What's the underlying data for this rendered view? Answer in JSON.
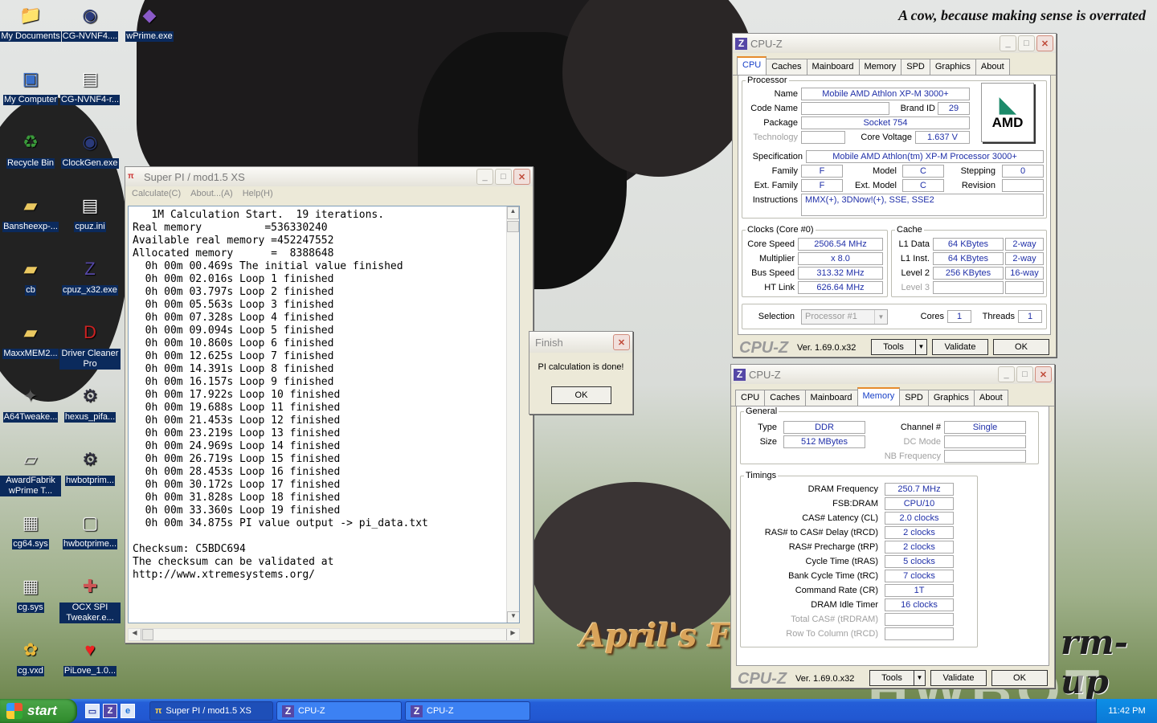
{
  "desktop": {
    "slogan": "A cow, because making sense is overrated",
    "banner_left": "April's F",
    "banner_right": "rm-up",
    "banner_logo": "HWBOT",
    "icons": [
      {
        "label": "My Documents",
        "icon": "folder-documents-icon"
      },
      {
        "label": "CG-NVNF4....",
        "icon": "clockgen-icon"
      },
      {
        "label": "wPrime.exe",
        "icon": "wprime-icon"
      },
      {
        "label": "My Computer",
        "icon": "computer-icon"
      },
      {
        "label": "CG-NVNF4-r...",
        "icon": "text-file-icon"
      },
      {
        "label": "Recycle Bin",
        "icon": "recycle-bin-icon"
      },
      {
        "label": "ClockGen.exe",
        "icon": "clockgen-icon"
      },
      {
        "label": "Bansheexp-...",
        "icon": "folder-icon"
      },
      {
        "label": "cpuz.ini",
        "icon": "ini-file-icon"
      },
      {
        "label": "cb",
        "icon": "folder-icon"
      },
      {
        "label": "cpuz_x32.exe",
        "icon": "cpuz-icon"
      },
      {
        "label": "MaxxMEM2...",
        "icon": "folder-icon"
      },
      {
        "label": "Driver Cleaner Pro",
        "icon": "driver-cleaner-icon"
      },
      {
        "label": "A64Tweake...",
        "icon": "a64tweaker-icon"
      },
      {
        "label": "hexus_pifa...",
        "icon": "app-window-icon"
      },
      {
        "label": "AwardFabrik wPrime T...",
        "icon": "award-icon"
      },
      {
        "label": "hwbotprim...",
        "icon": "app-window-icon"
      },
      {
        "label": "cg64.sys",
        "icon": "sys-file-icon"
      },
      {
        "label": "hwbotprime...",
        "icon": "file-icon"
      },
      {
        "label": "cg.sys",
        "icon": "sys-file-icon"
      },
      {
        "label": "OCX SPI Tweaker.e...",
        "icon": "ocx-icon"
      },
      {
        "label": "cg.vxd",
        "icon": "vxd-file-icon"
      },
      {
        "label": "PiLove_1.0...",
        "icon": "heart-icon"
      }
    ]
  },
  "superpi": {
    "title": "Super PI / mod1.5 XS",
    "menu": [
      "Calculate(C)",
      "About...(A)",
      "Help(H)"
    ],
    "output": "   1M Calculation Start.  19 iterations.\nReal memory          =536330240\nAvailable real memory =452247552\nAllocated memory      =  8388648\n  0h 00m 00.469s The initial value finished\n  0h 00m 02.016s Loop 1 finished\n  0h 00m 03.797s Loop 2 finished\n  0h 00m 05.563s Loop 3 finished\n  0h 00m 07.328s Loop 4 finished\n  0h 00m 09.094s Loop 5 finished\n  0h 00m 10.860s Loop 6 finished\n  0h 00m 12.625s Loop 7 finished\n  0h 00m 14.391s Loop 8 finished\n  0h 00m 16.157s Loop 9 finished\n  0h 00m 17.922s Loop 10 finished\n  0h 00m 19.688s Loop 11 finished\n  0h 00m 21.453s Loop 12 finished\n  0h 00m 23.219s Loop 13 finished\n  0h 00m 24.969s Loop 14 finished\n  0h 00m 26.719s Loop 15 finished\n  0h 00m 28.453s Loop 16 finished\n  0h 00m 30.172s Loop 17 finished\n  0h 00m 31.828s Loop 18 finished\n  0h 00m 33.360s Loop 19 finished\n  0h 00m 34.875s PI value output -> pi_data.txt\n\nChecksum: C5BDC694\nThe checksum can be validated at\nhttp://www.xtremesystems.org/"
  },
  "finish_dialog": {
    "title": "Finish",
    "message": "PI calculation is done!",
    "ok": "OK"
  },
  "cpuz_cpu": {
    "title": "CPU-Z",
    "tabs": [
      "CPU",
      "Caches",
      "Mainboard",
      "Memory",
      "SPD",
      "Graphics",
      "About"
    ],
    "processor_legend": "Processor",
    "name_label": "Name",
    "name": "Mobile AMD Athlon XP-M 3000+",
    "codename_label": "Code Name",
    "codename": "",
    "brandid_label": "Brand ID",
    "brandid": "29",
    "package_label": "Package",
    "package": "Socket 754",
    "technology_label": "Technology",
    "technology": "",
    "corevoltage_label": "Core Voltage",
    "corevoltage": "1.637 V",
    "logo": "AMD",
    "spec_label": "Specification",
    "spec": "Mobile AMD Athlon(tm) XP-M Processor 3000+",
    "family_label": "Family",
    "family": "F",
    "model_label": "Model",
    "model": "C",
    "stepping_label": "Stepping",
    "stepping": "0",
    "extfamily_label": "Ext. Family",
    "extfamily": "F",
    "extmodel_label": "Ext. Model",
    "extmodel": "C",
    "revision_label": "Revision",
    "revision": "",
    "instructions_label": "Instructions",
    "instructions": "MMX(+), 3DNow!(+), SSE, SSE2",
    "clocks_legend": "Clocks (Core #0)",
    "corespeed_label": "Core Speed",
    "corespeed": "2506.54 MHz",
    "multiplier_label": "Multiplier",
    "multiplier": "x 8.0",
    "busspeed_label": "Bus Speed",
    "busspeed": "313.32 MHz",
    "htlink_label": "HT Link",
    "htlink": "626.64 MHz",
    "cache_legend": "Cache",
    "l1d_label": "L1 Data",
    "l1d": "64 KBytes",
    "l1d_way": "2-way",
    "l1i_label": "L1 Inst.",
    "l1i": "64 KBytes",
    "l1i_way": "2-way",
    "l2_label": "Level 2",
    "l2": "256 KBytes",
    "l2_way": "16-way",
    "l3_label": "Level 3",
    "l3": "",
    "selection_label": "Selection",
    "selection": "Processor #1",
    "cores_label": "Cores",
    "cores": "1",
    "threads_label": "Threads",
    "threads": "1",
    "brand": "CPU-Z",
    "version": "Ver. 1.69.0.x32",
    "tools": "Tools",
    "validate": "Validate",
    "ok": "OK"
  },
  "cpuz_mem": {
    "title": "CPU-Z",
    "tabs": [
      "CPU",
      "Caches",
      "Mainboard",
      "Memory",
      "SPD",
      "Graphics",
      "About"
    ],
    "general_legend": "General",
    "type_label": "Type",
    "type": "DDR",
    "size_label": "Size",
    "size": "512 MBytes",
    "channel_label": "Channel #",
    "channel": "Single",
    "dcmode_label": "DC Mode",
    "dcmode": "",
    "nbfreq_label": "NB Frequency",
    "nbfreq": "",
    "timings_legend": "Timings",
    "timings": [
      {
        "label": "DRAM Frequency",
        "value": "250.7 MHz",
        "dim": false
      },
      {
        "label": "FSB:DRAM",
        "value": "CPU/10",
        "dim": false
      },
      {
        "label": "CAS# Latency (CL)",
        "value": "2.0 clocks",
        "dim": false
      },
      {
        "label": "RAS# to CAS# Delay (tRCD)",
        "value": "2 clocks",
        "dim": false
      },
      {
        "label": "RAS# Precharge (tRP)",
        "value": "2 clocks",
        "dim": false
      },
      {
        "label": "Cycle Time (tRAS)",
        "value": "5 clocks",
        "dim": false
      },
      {
        "label": "Bank Cycle Time (tRC)",
        "value": "7 clocks",
        "dim": false
      },
      {
        "label": "Command Rate (CR)",
        "value": "1T",
        "dim": false
      },
      {
        "label": "DRAM Idle Timer",
        "value": "16 clocks",
        "dim": false
      },
      {
        "label": "Total CAS# (tRDRAM)",
        "value": "",
        "dim": true
      },
      {
        "label": "Row To Column (tRCD)",
        "value": "",
        "dim": true
      }
    ],
    "brand": "CPU-Z",
    "version": "Ver. 1.69.0.x32",
    "tools": "Tools",
    "validate": "Validate",
    "ok": "OK"
  },
  "taskbar": {
    "start": "start",
    "quicklaunch": [
      "show-desktop-icon",
      "cpuz-icon",
      "ie-icon"
    ],
    "tasks": [
      {
        "label": "Super PI / mod1.5 XS",
        "icon": "superpi-icon",
        "active": true
      },
      {
        "label": "CPU-Z",
        "icon": "cpuz-icon",
        "active": false
      },
      {
        "label": "CPU-Z",
        "icon": "cpuz-icon",
        "active": false
      }
    ],
    "clock": "11:42 PM"
  }
}
